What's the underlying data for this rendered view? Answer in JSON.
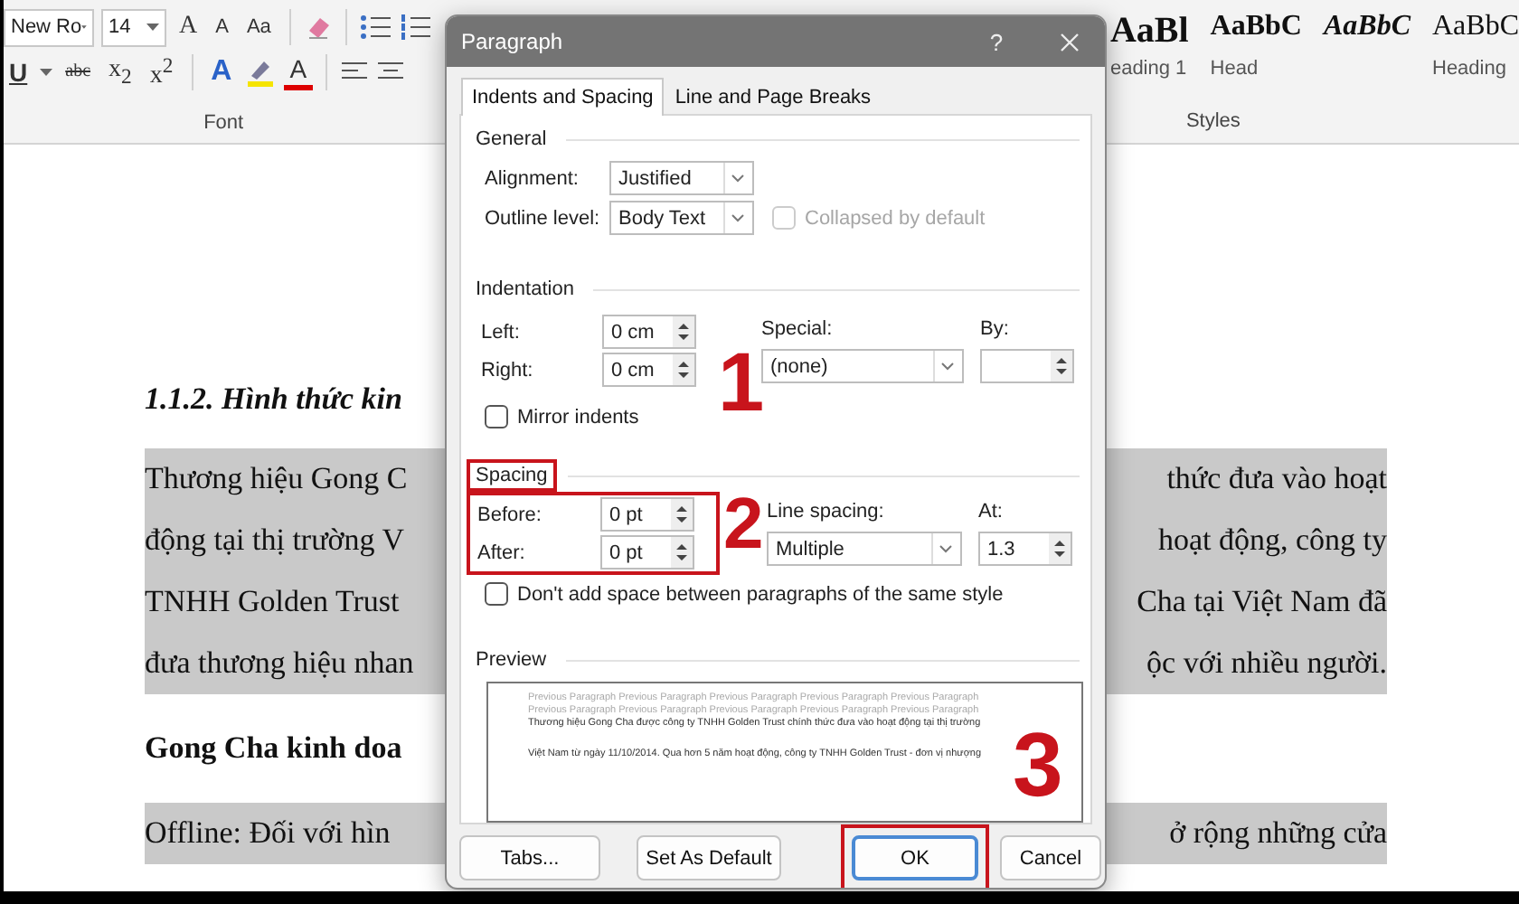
{
  "ribbon": {
    "font_group": {
      "font_name": "New Ro",
      "font_size": "14",
      "grow": "A",
      "shrink": "A",
      "change_case": "Aa",
      "underline": "U",
      "strikethrough": "abc",
      "subscript": "x$_{2}$",
      "superscript": "x$^{2}$",
      "text_effects": "A",
      "font_color": "A",
      "label": "Font"
    },
    "styles_group": {
      "styles": [
        {
          "sample": "AaBl",
          "name": "eading 1",
          "kind": "title"
        },
        {
          "sample": "AaBbC",
          "name": "Head",
          "kind": "strong"
        },
        {
          "sample": "AaBbC",
          "kind": "emphasis"
        },
        {
          "sample": "AaBbC",
          "name": "Heading",
          "kind": "plain"
        }
      ],
      "label": "Styles"
    }
  },
  "document": {
    "rows": [
      {
        "kind": "heading",
        "left": "1.1.2. Hình thức kin",
        "highlighted": false
      },
      {
        "kind": "body",
        "left": "Thương hiệu Gong C",
        "right": "thức đưa vào hoạt",
        "highlighted": true
      },
      {
        "kind": "body",
        "left": "động tại thị trường V",
        "right": "hoạt động, công ty",
        "highlighted": true
      },
      {
        "kind": "body",
        "left": "TNHH Golden Trust",
        "right": "Cha tại Việt Nam đã",
        "highlighted": true
      },
      {
        "kind": "body",
        "left": "đưa thương hiệu nhan",
        "right": "ộc với nhiều người.",
        "highlighted": true
      },
      {
        "kind": "bold",
        "left": "Gong Cha kinh doa",
        "highlighted": false
      },
      {
        "kind": "body",
        "left": "Offline: Đối với hìn",
        "right": "ở rộng những cửa",
        "highlighted": true
      }
    ]
  },
  "dialog": {
    "title": "Paragraph",
    "help": "?",
    "tabs": [
      {
        "label": "Indents and Spacing",
        "selected": true
      },
      {
        "label": "Line and Page Breaks",
        "selected": false
      }
    ],
    "general": {
      "heading": "General",
      "alignment": {
        "label": "Alignment:",
        "value": "Justified"
      },
      "outline_level": {
        "label": "Outline level:",
        "value": "Body Text"
      },
      "collapsed": {
        "label": "Collapsed by default",
        "checked": false,
        "disabled": true
      }
    },
    "indentation": {
      "heading": "Indentation",
      "left": {
        "label": "Left:",
        "value": "0 cm"
      },
      "right": {
        "label": "Right:",
        "value": "0 cm"
      },
      "special": {
        "label": "Special:",
        "value": "(none)"
      },
      "by": {
        "label": "By:"
      },
      "mirror": {
        "label": "Mirror indents",
        "checked": false,
        "disabled": false
      }
    },
    "spacing": {
      "heading": "Spacing",
      "heading_marked": true,
      "fields_marked": true,
      "before": {
        "label": "Before:",
        "value": "0 pt"
      },
      "after": {
        "label": "After:",
        "value": "0 pt"
      },
      "line_spacing": {
        "label": "Line spacing:",
        "value": "Multiple"
      },
      "at": {
        "label": "At:",
        "value": "1.3"
      },
      "dont_add": {
        "label": "Don't add space between paragraphs of the same style",
        "checked": false,
        "disabled": false
      }
    },
    "preview": {
      "heading": "Preview",
      "previous_lines": [
        "Previous Paragraph Previous Paragraph Previous Paragraph Previous Paragraph Previous Paragraph",
        "Previous Paragraph Previous Paragraph Previous Paragraph Previous Paragraph Previous Paragraph"
      ],
      "sample_lines": [
        "Thương hiệu Gong Cha được công ty TNHH Golden Trust chính thức đưa vào hoạt động tại thị trường",
        "Việt Nam từ ngày 11/10/2014. Qua hơn 5 năm hoạt động, công ty TNHH Golden Trust - đơn vị nhượng"
      ]
    },
    "buttons": [
      {
        "label": "Tabs...",
        "default": false,
        "marked": false
      },
      {
        "label": "Set As Default",
        "default": false,
        "marked": false
      },
      {
        "label": "OK",
        "default": true,
        "marked": true
      },
      {
        "label": "Cancel",
        "default": false,
        "marked": false
      }
    ]
  },
  "annotations": [
    {
      "label": "1"
    },
    {
      "label": "2"
    },
    {
      "label": "3"
    }
  ]
}
